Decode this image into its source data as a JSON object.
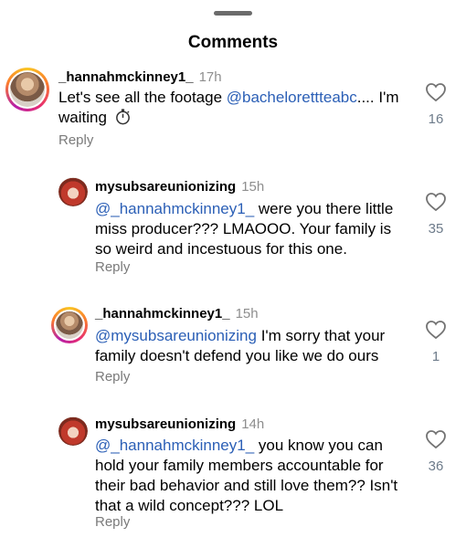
{
  "header": {
    "title": "Comments"
  },
  "comments": [
    {
      "username": "_hannahmckinney1_",
      "time": "17h",
      "mention": "@bachelorettteabc",
      "text_before": "Let's see all the footage ",
      "text_after": ".... I'm waiting",
      "emoji": "stopwatch-icon",
      "reply_label": "Reply",
      "likes": "16"
    },
    {
      "username": "mysubsareunionizing",
      "time": "15h",
      "mention": "@_hannahmckinney1_",
      "text_after": " were you there little miss producer??? LMAOOO. Your family is so weird and incestuous for this one.",
      "reply_label": "Reply",
      "likes": "35"
    },
    {
      "username": "_hannahmckinney1_",
      "time": "15h",
      "mention": "@mysubsareunionizing",
      "text_after": " I'm sorry that your family doesn't defend you like we do ours",
      "reply_label": "Reply",
      "likes": "1"
    },
    {
      "username": "mysubsareunionizing",
      "time": "14h",
      "mention": "@_hannahmckinney1_",
      "text_after": " you know you can hold your family members accountable for their bad behavior and still love them?? Isn't that a wild concept??? LOL",
      "reply_label": "Reply",
      "likes": "36"
    }
  ]
}
